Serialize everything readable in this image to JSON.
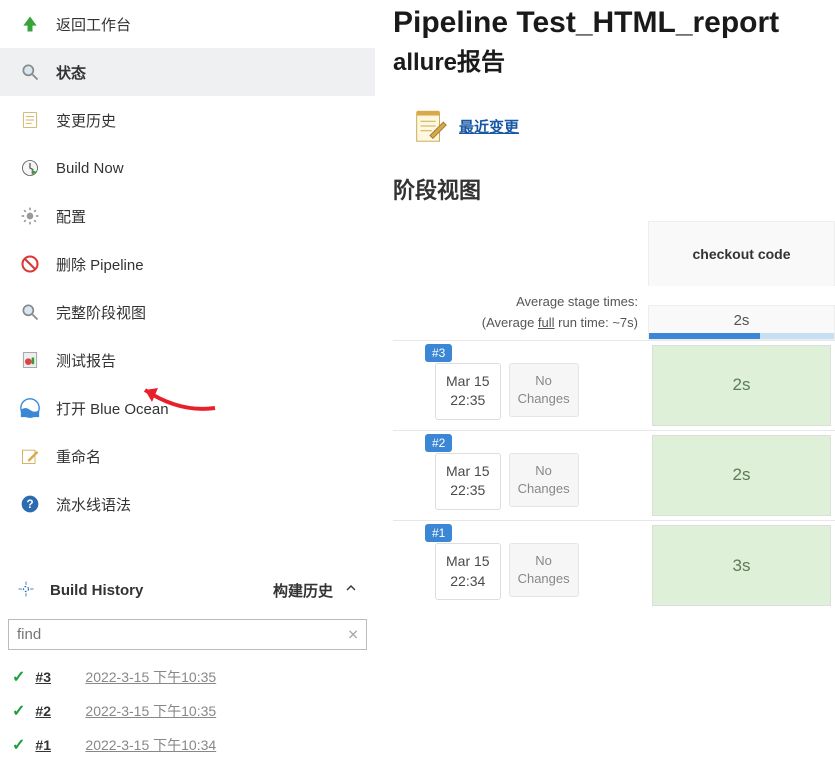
{
  "sidebar": {
    "items": [
      {
        "label": "返回工作台"
      },
      {
        "label": "状态"
      },
      {
        "label": "变更历史"
      },
      {
        "label": "Build Now"
      },
      {
        "label": "配置"
      },
      {
        "label": "删除 Pipeline"
      },
      {
        "label": "完整阶段视图"
      },
      {
        "label": "测试报告"
      },
      {
        "label": "打开 Blue Ocean"
      },
      {
        "label": "重命名"
      },
      {
        "label": "流水线语法"
      }
    ]
  },
  "buildHistory": {
    "title_en": "Build History",
    "title_zh": "构建历史",
    "find_placeholder": "find",
    "builds": [
      {
        "num": "#3",
        "date": "2022-3-15 下午10:35"
      },
      {
        "num": "#2",
        "date": "2022-3-15 下午10:35"
      },
      {
        "num": "#1",
        "date": "2022-3-15 下午10:34"
      }
    ]
  },
  "main": {
    "title": "Pipeline Test_HTML_report",
    "subtitle": "allure报告",
    "recent_changes": "最近变更",
    "stage_section": "阶段视图",
    "stage_header": "checkout code",
    "avg_line1": "Average stage times:",
    "avg_line2a": "(Average ",
    "avg_line2b": "full",
    "avg_line2c": " run time: ~7s)",
    "avg_value": "2s",
    "changes_line1": "No",
    "changes_line2": "Changes",
    "runs": [
      {
        "badge": "#3",
        "date": "Mar 15",
        "time": "22:35",
        "duration": "2s"
      },
      {
        "badge": "#2",
        "date": "Mar 15",
        "time": "22:35",
        "duration": "2s"
      },
      {
        "badge": "#1",
        "date": "Mar 15",
        "time": "22:34",
        "duration": "3s"
      }
    ]
  }
}
